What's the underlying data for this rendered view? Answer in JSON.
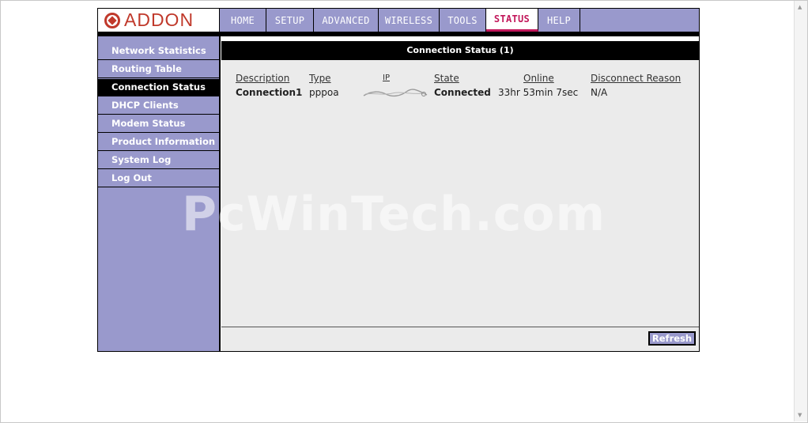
{
  "brand": {
    "name": "ADDON",
    "logo_color": "#c0392b"
  },
  "nav": {
    "tabs": [
      {
        "label": "HOME"
      },
      {
        "label": "SETUP"
      },
      {
        "label": "ADVANCED"
      },
      {
        "label": "WIRELESS"
      },
      {
        "label": "TOOLS"
      },
      {
        "label": "STATUS",
        "active": true
      },
      {
        "label": "HELP"
      }
    ]
  },
  "sidebar": {
    "items": [
      {
        "label": "Network Statistics"
      },
      {
        "label": "Routing Table"
      },
      {
        "label": "Connection Status",
        "active": true
      },
      {
        "label": "DHCP Clients"
      },
      {
        "label": "Modem Status"
      },
      {
        "label": "Product Information"
      },
      {
        "label": "System Log"
      },
      {
        "label": "Log Out"
      }
    ]
  },
  "main": {
    "title": "Connection Status (1)",
    "columns": {
      "description": "Description",
      "type": "Type",
      "ip": "IP",
      "state": "State",
      "online": "Online",
      "disconnect_reason": "Disconnect Reason"
    },
    "row": {
      "description": "Connection1",
      "type": "pppoa",
      "state": "Connected",
      "online": "33hr 53min 7sec",
      "disconnect_reason": "N/A"
    },
    "refresh_label": "Refresh"
  },
  "watermark": "PcWinTech.com",
  "colors": {
    "nav_bg": "#9999cc",
    "active_tab": "#c2185b",
    "content_bg": "#ebebeb"
  }
}
